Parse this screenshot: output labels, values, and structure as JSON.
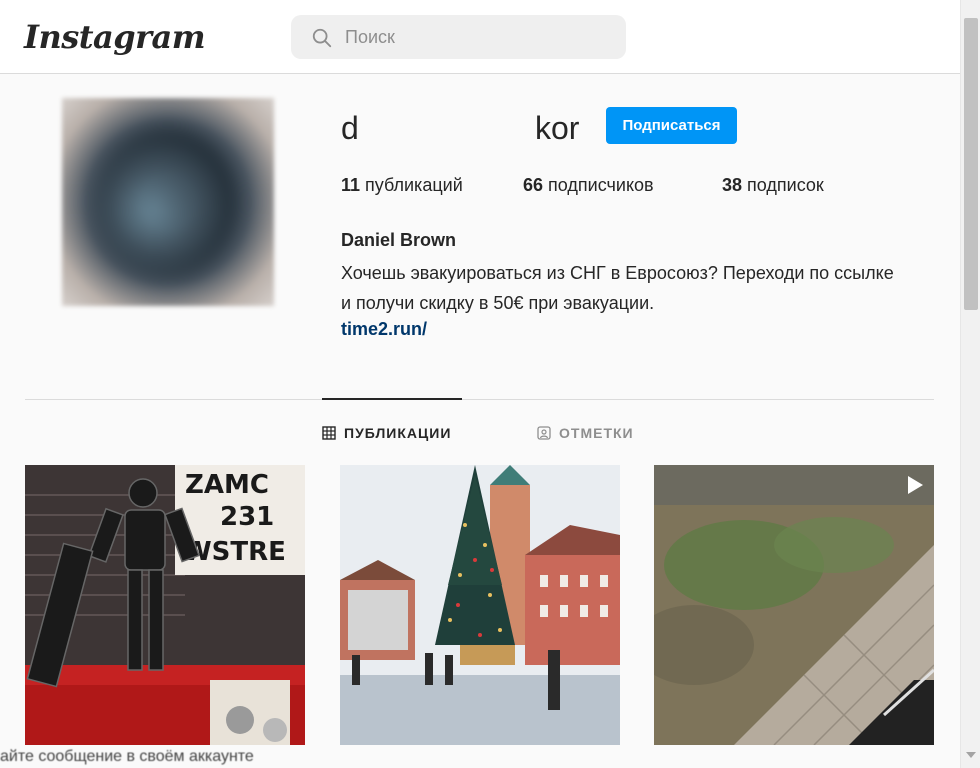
{
  "header": {
    "logo": "Instagram",
    "search": {
      "placeholder": "Поиск",
      "value": ""
    }
  },
  "profile": {
    "username_part1": "d",
    "username_part2": "kor",
    "follow_label": "Подписаться",
    "stats": {
      "posts_count": "11",
      "posts_label": "публикаций",
      "followers_count": "66",
      "followers_label": "подписчиков",
      "following_count": "38",
      "following_label": "подписок"
    },
    "full_name": "Daniel Brown",
    "bio": "Хочешь эвакуироваться из СНГ в Евросоюз? Переходи по ссылке и получи скидку в 50€ при эвакуации.",
    "link": "time2.run/"
  },
  "tabs": {
    "publications": "ПУБЛИКАЦИИ",
    "tagged": "ОТМЕТКИ",
    "active": "publications"
  },
  "posts": [
    {
      "kind": "image",
      "icon": ""
    },
    {
      "kind": "image",
      "icon": ""
    },
    {
      "kind": "video",
      "icon": "play-icon"
    }
  ],
  "post1_sign_text": [
    "ZAMC",
    "231",
    "WSTRE"
  ],
  "bottom_strip_text": "айте сообщение в своём аккаунте"
}
